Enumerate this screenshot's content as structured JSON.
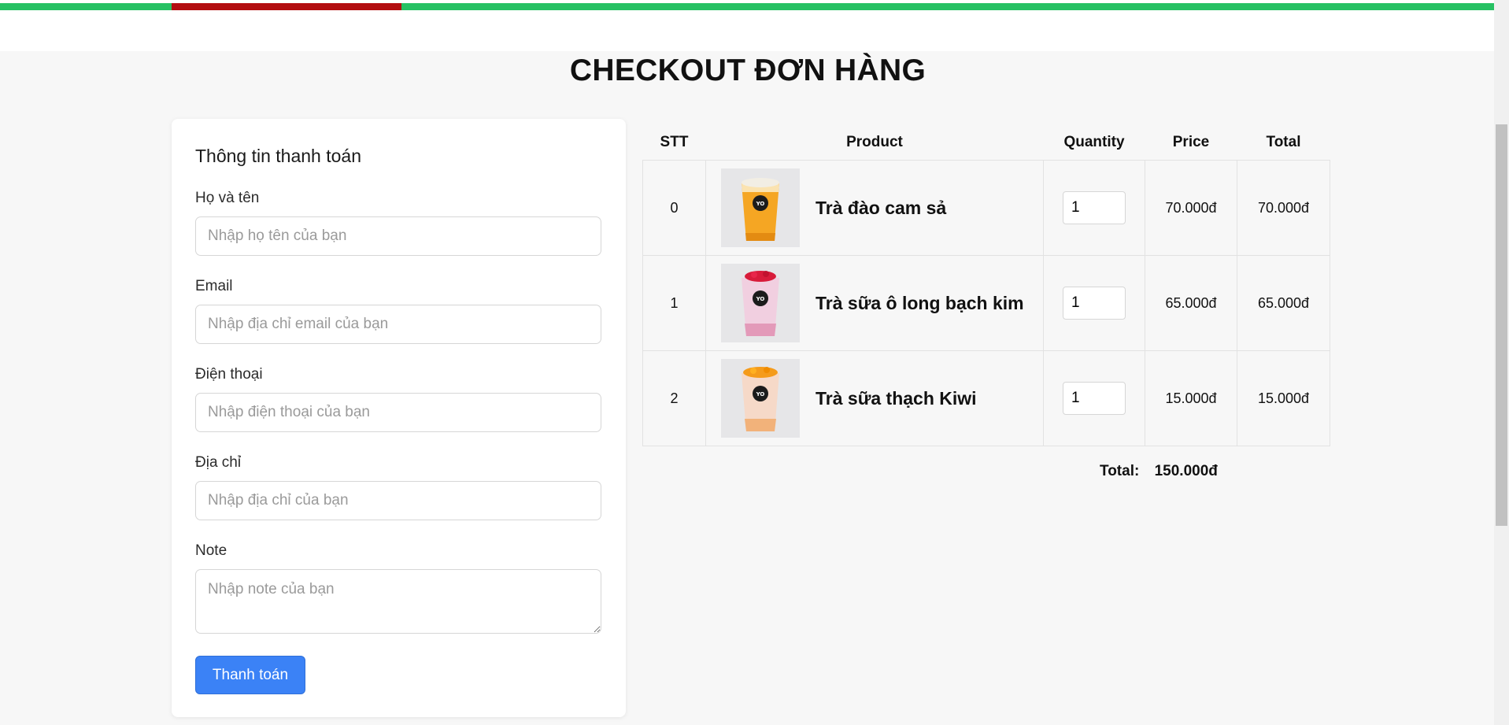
{
  "colors": {
    "top_stripe": "#27c163",
    "top_stripe_accent": "#b30e10",
    "button": "#3b82f6"
  },
  "page": {
    "title": "CHECKOUT ĐƠN HÀNG"
  },
  "billing_form": {
    "title": "Thông tin thanh toán",
    "fields": [
      {
        "label": "Họ và tên",
        "placeholder": "Nhập họ tên của bạn",
        "value": ""
      },
      {
        "label": "Email",
        "placeholder": "Nhập địa chỉ email của bạn",
        "value": ""
      },
      {
        "label": "Điện thoại",
        "placeholder": "Nhập điện thoại của bạn",
        "value": ""
      },
      {
        "label": "Địa chỉ",
        "placeholder": "Nhập địa chỉ của bạn",
        "value": ""
      },
      {
        "label": "Note",
        "placeholder": "Nhập note của bạn",
        "value": ""
      }
    ],
    "submit_label": "Thanh toán"
  },
  "cart": {
    "headers": {
      "stt": "STT",
      "product": "Product",
      "quantity": "Quantity",
      "price": "Price",
      "total": "Total"
    },
    "items": [
      {
        "stt": "0",
        "name": "Trà đào cam sả",
        "quantity": "1",
        "price": "70.000đ",
        "total": "70.000đ",
        "image_icon": "peach-tea-cup-icon"
      },
      {
        "stt": "1",
        "name": "Trà sữa ô long bạch kim",
        "quantity": "1",
        "price": "65.000đ",
        "total": "65.000đ",
        "image_icon": "oolong-milk-tea-cup-icon"
      },
      {
        "stt": "2",
        "name": "Trà sữa thạch Kiwi",
        "quantity": "1",
        "price": "15.000đ",
        "total": "15.000đ",
        "image_icon": "kiwi-jelly-milk-tea-cup-icon"
      }
    ],
    "total_label": "Total:",
    "total_value": "150.000đ"
  }
}
